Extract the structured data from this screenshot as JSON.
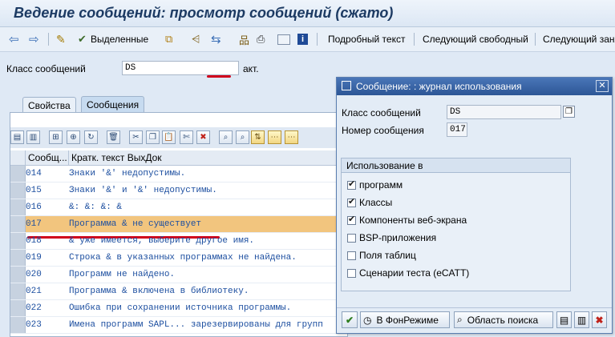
{
  "window": {
    "title": "Ведение сообщений: просмотр сообщений (сжато)"
  },
  "toolbar": {
    "selected_label": "Выделенные",
    "detail_label": "Подробный текст",
    "next_free_label": "Следующий свободный",
    "next_taken_label": "Следующий заня"
  },
  "header": {
    "class_label": "Класс сообщений",
    "class_value": "DS",
    "status": "акт."
  },
  "tabs": [
    {
      "label": "Свойства",
      "active": false
    },
    {
      "label": "Сообщения",
      "active": true
    }
  ],
  "grid": {
    "columns": [
      "Сообщ...",
      "Кратк. текст ВыхДок"
    ],
    "rows": [
      {
        "num": "014",
        "text": "Знаки '&' недопустимы."
      },
      {
        "num": "015",
        "text": "Знаки '&' и '&' недопустимы."
      },
      {
        "num": "016",
        "text": "&: &: &: &"
      },
      {
        "num": "017",
        "text": "Программа & не существует"
      },
      {
        "num": "018",
        "text": "& уже имеется, выберите другое имя."
      },
      {
        "num": "019",
        "text": "Строка & в указанных программах не найдена."
      },
      {
        "num": "020",
        "text": "Программ не найдено."
      },
      {
        "num": "021",
        "text": "Программа & включена в библиотеку."
      },
      {
        "num": "022",
        "text": "Ошибка при сохранении источника программы."
      },
      {
        "num": "023",
        "text": "Имена программ SAPL... зарезервированы для групп"
      }
    ],
    "highlight_color": "#f2c57e"
  },
  "dialog": {
    "title": "Сообщение: : журнал использования",
    "class_label": "Класс сообщений",
    "class_value": "DS",
    "number_label": "Номер сообщения",
    "number_value": "017",
    "group_title": "Использование в",
    "options": [
      {
        "label": "программ",
        "checked": true
      },
      {
        "label": "Классы",
        "checked": true
      },
      {
        "label": "Компоненты веб-экрана",
        "checked": true
      },
      {
        "label": "BSP-приложения",
        "checked": false
      },
      {
        "label": "Поля таблиц",
        "checked": false
      },
      {
        "label": "Сценарии теста (eCATT)",
        "checked": false
      }
    ],
    "buttons": {
      "background_label": "В ФонРежиме",
      "search_area_label": "Область поиска"
    }
  },
  "colors": {
    "accent": "#2c5696",
    "marker": "#d0021b"
  }
}
